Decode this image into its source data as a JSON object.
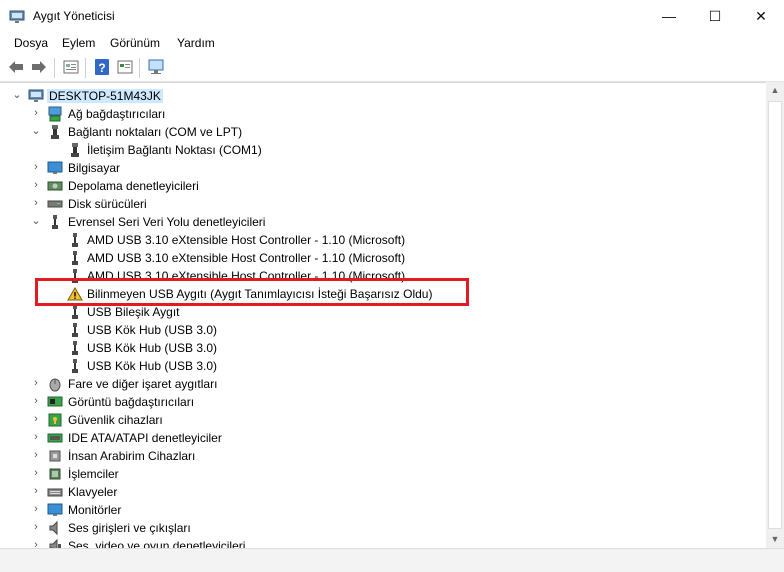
{
  "window": {
    "title": "Aygıt Yöneticisi",
    "minimize_symbol": "—",
    "maximize_symbol": "☐",
    "close_symbol": "✕"
  },
  "menu": {
    "items": [
      "Dosya",
      "Eylem",
      "Görünüm",
      "Yardım"
    ]
  },
  "toolbar": {
    "icons": [
      "back-arrow-icon",
      "forward-arrow-icon",
      "properties-icon",
      "help-icon",
      "update-driver-icon",
      "scan-hardware-icon"
    ]
  },
  "tree": {
    "root": "DESKTOP-51M43JK",
    "items": [
      {
        "label": "Ağ bağdaştırıcıları",
        "icon": "network-adapter-icon",
        "expanded": false
      },
      {
        "label": "Bağlantı noktaları (COM ve LPT)",
        "icon": "port-icon",
        "expanded": true
      },
      {
        "label": "İletişim Bağlantı Noktası (COM1)",
        "icon": "port-icon",
        "child": true
      },
      {
        "label": "Bilgisayar",
        "icon": "computer-icon",
        "expanded": false
      },
      {
        "label": "Depolama denetleyicileri",
        "icon": "storage-controller-icon",
        "expanded": false
      },
      {
        "label": "Disk sürücüleri",
        "icon": "disk-drive-icon",
        "expanded": false
      },
      {
        "label": "Evrensel Seri Veri Yolu denetleyicileri",
        "icon": "usb-icon",
        "expanded": true
      },
      {
        "label": "AMD USB 3.10 eXtensible Host Controller - 1.10 (Microsoft)",
        "icon": "usb-icon",
        "child": true
      },
      {
        "label": "AMD USB 3.10 eXtensible Host Controller - 1.10 (Microsoft)",
        "icon": "usb-icon",
        "child": true
      },
      {
        "label": "AMD USB 3.10 eXtensible Host Controller - 1.10 (Microsoft)",
        "icon": "usb-icon",
        "child": true
      },
      {
        "label": "Bilinmeyen USB Aygıtı (Aygıt Tanımlayıcısı İsteği Başarısız Oldu)",
        "icon": "warning-icon",
        "child": true
      },
      {
        "label": "USB Bileşik Aygıt",
        "icon": "usb-icon",
        "child": true
      },
      {
        "label": "USB Kök Hub (USB 3.0)",
        "icon": "usb-icon",
        "child": true
      },
      {
        "label": "USB Kök Hub (USB 3.0)",
        "icon": "usb-icon",
        "child": true
      },
      {
        "label": "USB Kök Hub (USB 3.0)",
        "icon": "usb-icon",
        "child": true
      },
      {
        "label": "Fare ve diğer işaret aygıtları",
        "icon": "mouse-icon",
        "expanded": false
      },
      {
        "label": "Görüntü bağdaştırıcıları",
        "icon": "display-adapter-icon",
        "expanded": false
      },
      {
        "label": "Güvenlik cihazları",
        "icon": "security-device-icon",
        "expanded": false
      },
      {
        "label": "IDE ATA/ATAPI denetleyiciler",
        "icon": "ide-controller-icon",
        "expanded": false
      },
      {
        "label": "İnsan Arabirim Cihazları",
        "icon": "hid-icon",
        "expanded": false
      },
      {
        "label": "İşlemciler",
        "icon": "processor-icon",
        "expanded": false
      },
      {
        "label": "Klavyeler",
        "icon": "keyboard-icon",
        "expanded": false
      },
      {
        "label": "Monitörler",
        "icon": "monitor-icon",
        "expanded": false
      },
      {
        "label": "Ses girişleri ve çıkışları",
        "icon": "audio-icon",
        "expanded": false
      },
      {
        "label": "Ses, video ve oyun denetleyicileri",
        "icon": "sound-controller-icon",
        "expanded": false
      }
    ]
  },
  "colors": {
    "highlight_border": "#e21b22",
    "root_selection": "#cde8ff",
    "warning": "#f2c230"
  }
}
